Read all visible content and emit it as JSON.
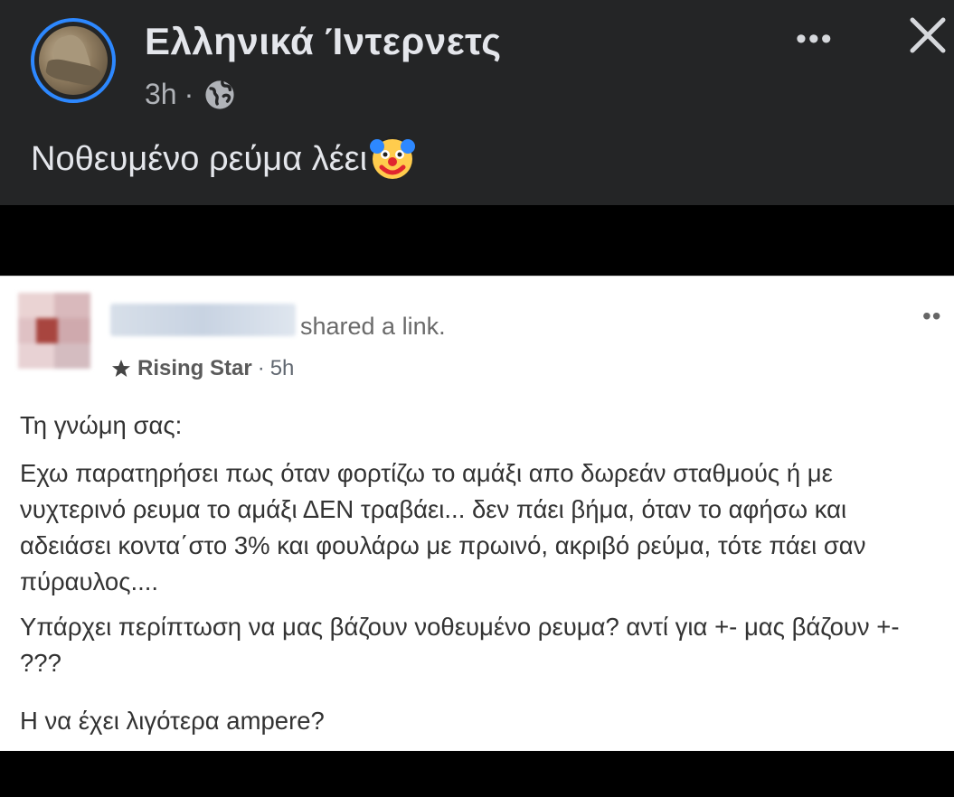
{
  "post": {
    "page_name": "Ελληνικά Ίντερνετς",
    "time": "3h",
    "separator": "·",
    "caption": "Νοθευμένο ρεύμα λέει"
  },
  "icons": {
    "globe": "globe-icon",
    "more": "more-options-icon",
    "close": "close-icon",
    "clown": "clown-face-emoji",
    "star": "star-badge-icon"
  },
  "shared_post": {
    "shared_text": "shared a link.",
    "badge": "Rising Star",
    "badge_sep": "·",
    "time": "5h",
    "paragraphs": [
      "Τη γνώμη σας:",
      "Εχω παρατηρήσει πως όταν φορτίζω το αμάξι απο δωρεάν σταθμούς ή με νυχτερινό ρευμα το αμάξι ΔΕΝ τραβάει... δεν πάει βήμα, όταν το αφήσω και αδειάσει κοντα΄στο 3% και φουλάρω με πρωινό, ακριβό ρεύμα, τότε πάει σαν πύραυλος....",
      "Υπάρχει περίπτωση να μας βάζουν νοθευμένο ρευμα? αντί για +- μας βάζουν +- ???",
      "Η να έχει λιγότερα ampere?"
    ]
  },
  "colors": {
    "dark_bg": "#242526",
    "accent_ring": "#2d88ff",
    "text_light": "#e4e6eb",
    "text_muted": "#b0b3b8"
  }
}
